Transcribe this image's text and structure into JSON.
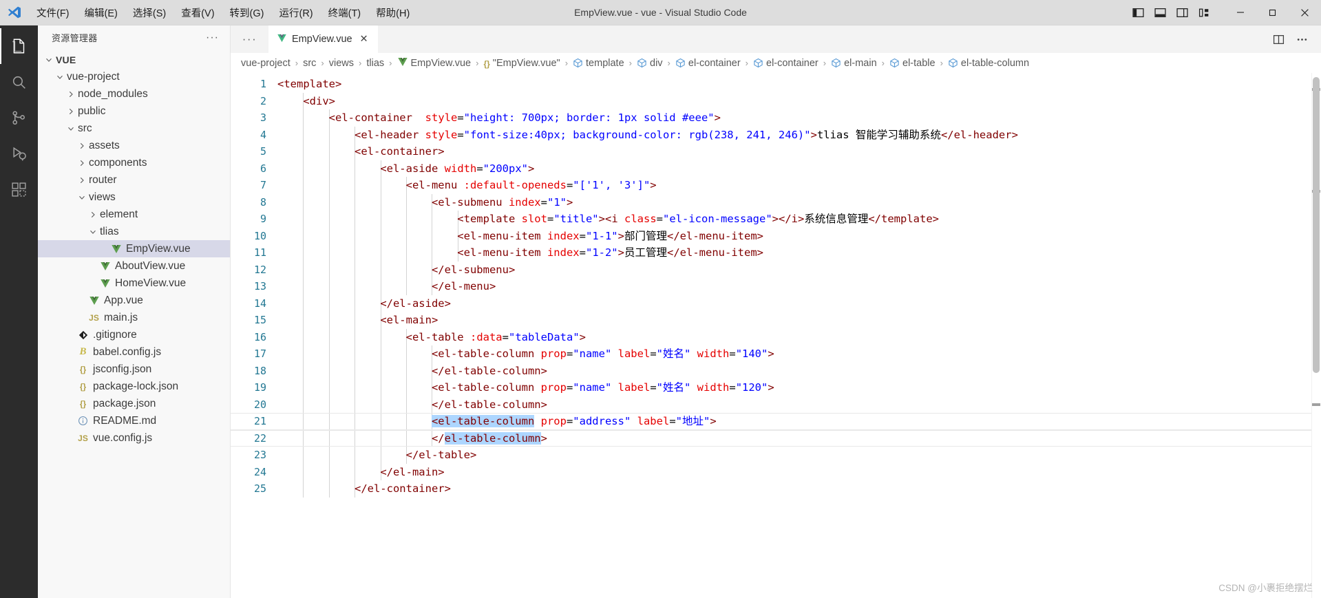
{
  "window": {
    "title": "EmpView.vue - vue - Visual Studio Code",
    "logo_icon": "vscode-logo-icon",
    "menu": [
      {
        "label": "文件(F)",
        "name": "menu-file"
      },
      {
        "label": "编辑(E)",
        "name": "menu-edit"
      },
      {
        "label": "选择(S)",
        "name": "menu-selection"
      },
      {
        "label": "查看(V)",
        "name": "menu-view"
      },
      {
        "label": "转到(G)",
        "name": "menu-go"
      },
      {
        "label": "运行(R)",
        "name": "menu-run"
      },
      {
        "label": "终端(T)",
        "name": "menu-terminal"
      },
      {
        "label": "帮助(H)",
        "name": "menu-help"
      }
    ],
    "layout_icons": [
      {
        "name": "toggle-primary-sidebar-icon"
      },
      {
        "name": "toggle-panel-icon"
      },
      {
        "name": "toggle-secondary-sidebar-icon"
      },
      {
        "name": "customize-layout-icon"
      }
    ],
    "controls": [
      {
        "name": "minimize-button",
        "glyph": "─"
      },
      {
        "name": "maximize-button",
        "glyph": "❐"
      },
      {
        "name": "close-button",
        "glyph": "✕"
      }
    ]
  },
  "activitybar": {
    "items": [
      {
        "name": "activity-explorer",
        "icon": "files-icon",
        "active": true
      },
      {
        "name": "activity-search",
        "icon": "search-icon",
        "active": false
      },
      {
        "name": "activity-source-control",
        "icon": "source-control-icon",
        "active": false
      },
      {
        "name": "activity-run-debug",
        "icon": "run-and-debug-icon",
        "active": false
      },
      {
        "name": "activity-extensions",
        "icon": "extensions-icon",
        "active": false
      }
    ]
  },
  "sidebar": {
    "title": "资源管理器",
    "more_actions": "···",
    "tree": [
      {
        "label": "VUE",
        "indent": 0,
        "twisty": "down",
        "icon": "none",
        "bold": true,
        "selected": false
      },
      {
        "label": "vue-project",
        "indent": 1,
        "twisty": "down",
        "icon": "none",
        "bold": false,
        "selected": false
      },
      {
        "label": "node_modules",
        "indent": 2,
        "twisty": "right",
        "icon": "none",
        "bold": false,
        "selected": false
      },
      {
        "label": "public",
        "indent": 2,
        "twisty": "right",
        "icon": "none",
        "bold": false,
        "selected": false
      },
      {
        "label": "src",
        "indent": 2,
        "twisty": "down",
        "icon": "none",
        "bold": false,
        "selected": false
      },
      {
        "label": "assets",
        "indent": 3,
        "twisty": "right",
        "icon": "none",
        "bold": false,
        "selected": false
      },
      {
        "label": "components",
        "indent": 3,
        "twisty": "right",
        "icon": "none",
        "bold": false,
        "selected": false
      },
      {
        "label": "router",
        "indent": 3,
        "twisty": "right",
        "icon": "none",
        "bold": false,
        "selected": false
      },
      {
        "label": "views",
        "indent": 3,
        "twisty": "down",
        "icon": "none",
        "bold": false,
        "selected": false
      },
      {
        "label": "element",
        "indent": 4,
        "twisty": "right",
        "icon": "none",
        "bold": false,
        "selected": false
      },
      {
        "label": "tlias",
        "indent": 4,
        "twisty": "down",
        "icon": "none",
        "bold": false,
        "selected": false
      },
      {
        "label": "EmpView.vue",
        "indent": 5,
        "twisty": "none",
        "icon": "vue",
        "bold": false,
        "selected": true
      },
      {
        "label": "AboutView.vue",
        "indent": 4,
        "twisty": "none",
        "icon": "vue",
        "bold": false,
        "selected": false
      },
      {
        "label": "HomeView.vue",
        "indent": 4,
        "twisty": "none",
        "icon": "vue",
        "bold": false,
        "selected": false
      },
      {
        "label": "App.vue",
        "indent": 3,
        "twisty": "none",
        "icon": "vue",
        "bold": false,
        "selected": false
      },
      {
        "label": "main.js",
        "indent": 3,
        "twisty": "none",
        "icon": "js",
        "bold": false,
        "selected": false
      },
      {
        "label": ".gitignore",
        "indent": 2,
        "twisty": "none",
        "icon": "git",
        "bold": false,
        "selected": false
      },
      {
        "label": "babel.config.js",
        "indent": 2,
        "twisty": "none",
        "icon": "babel",
        "bold": false,
        "selected": false
      },
      {
        "label": "jsconfig.json",
        "indent": 2,
        "twisty": "none",
        "icon": "json",
        "bold": false,
        "selected": false
      },
      {
        "label": "package-lock.json",
        "indent": 2,
        "twisty": "none",
        "icon": "json",
        "bold": false,
        "selected": false
      },
      {
        "label": "package.json",
        "indent": 2,
        "twisty": "none",
        "icon": "json",
        "bold": false,
        "selected": false
      },
      {
        "label": "README.md",
        "indent": 2,
        "twisty": "none",
        "icon": "readme",
        "bold": false,
        "selected": false
      },
      {
        "label": "vue.config.js",
        "indent": 2,
        "twisty": "none",
        "icon": "js",
        "bold": false,
        "selected": false
      }
    ]
  },
  "editor": {
    "more_tab_actions": "···",
    "tabs": [
      {
        "label": "EmpView.vue",
        "icon": "vue-file-icon",
        "close": "✕",
        "active": true
      }
    ],
    "tab_actions": [
      {
        "name": "split-editor-icon"
      },
      {
        "name": "more-actions-icon"
      }
    ],
    "breadcrumbs": [
      {
        "label": "vue-project",
        "icon": "none"
      },
      {
        "label": "src",
        "icon": "none"
      },
      {
        "label": "views",
        "icon": "none"
      },
      {
        "label": "tlias",
        "icon": "none"
      },
      {
        "label": "EmpView.vue",
        "icon": "vue"
      },
      {
        "label": "\"EmpView.vue\"",
        "icon": "brace"
      },
      {
        "label": "template",
        "icon": "cube"
      },
      {
        "label": "div",
        "icon": "cube"
      },
      {
        "label": "el-container",
        "icon": "cube"
      },
      {
        "label": "el-container",
        "icon": "cube"
      },
      {
        "label": "el-main",
        "icon": "cube"
      },
      {
        "label": "el-table",
        "icon": "cube"
      },
      {
        "label": "el-table-column",
        "icon": "cube"
      }
    ],
    "line_numbers": [
      "1",
      "2",
      "3",
      "4",
      "5",
      "6",
      "7",
      "8",
      "9",
      "10",
      "11",
      "12",
      "13",
      "14",
      "15",
      "16",
      "17",
      "18",
      "19",
      "20",
      "21",
      "22",
      "23",
      "24",
      "25"
    ],
    "code_lines": [
      {
        "n": 1,
        "indent": 0,
        "tokens": [
          {
            "t": "tag",
            "v": "<template>"
          }
        ]
      },
      {
        "n": 2,
        "indent": 1,
        "tokens": [
          {
            "t": "tag",
            "v": "<div>"
          }
        ]
      },
      {
        "n": 3,
        "indent": 2,
        "tokens": [
          {
            "t": "tag",
            "v": "<el-container"
          },
          {
            "t": "txt",
            "v": "  "
          },
          {
            "t": "attr",
            "v": "style"
          },
          {
            "t": "punc",
            "v": "="
          },
          {
            "t": "val",
            "v": "\"height: 700px; border: 1px solid #eee\""
          },
          {
            "t": "tag",
            "v": ">"
          }
        ]
      },
      {
        "n": 4,
        "indent": 3,
        "tokens": [
          {
            "t": "tag",
            "v": "<el-header"
          },
          {
            "t": "txt",
            "v": " "
          },
          {
            "t": "attr",
            "v": "style"
          },
          {
            "t": "punc",
            "v": "="
          },
          {
            "t": "val",
            "v": "\"font-size:40px; background-color: rgb(238, 241, 246)\""
          },
          {
            "t": "tag",
            "v": ">"
          },
          {
            "t": "txt",
            "v": "tlias 智能学习辅助系统"
          },
          {
            "t": "tag",
            "v": "</el-header>"
          }
        ]
      },
      {
        "n": 5,
        "indent": 3,
        "tokens": [
          {
            "t": "tag",
            "v": "<el-container>"
          }
        ]
      },
      {
        "n": 6,
        "indent": 4,
        "tokens": [
          {
            "t": "tag",
            "v": "<el-aside"
          },
          {
            "t": "txt",
            "v": " "
          },
          {
            "t": "attr",
            "v": "width"
          },
          {
            "t": "punc",
            "v": "="
          },
          {
            "t": "val",
            "v": "\"200px\""
          },
          {
            "t": "tag",
            "v": ">"
          }
        ]
      },
      {
        "n": 7,
        "indent": 5,
        "tokens": [
          {
            "t": "tag",
            "v": "<el-menu"
          },
          {
            "t": "txt",
            "v": " "
          },
          {
            "t": "attr",
            "v": ":default-openeds"
          },
          {
            "t": "punc",
            "v": "="
          },
          {
            "t": "val",
            "v": "\"['1', '3']\""
          },
          {
            "t": "tag",
            "v": ">"
          }
        ]
      },
      {
        "n": 8,
        "indent": 6,
        "tokens": [
          {
            "t": "tag",
            "v": "<el-submenu"
          },
          {
            "t": "txt",
            "v": " "
          },
          {
            "t": "attr",
            "v": "index"
          },
          {
            "t": "punc",
            "v": "="
          },
          {
            "t": "val",
            "v": "\"1\""
          },
          {
            "t": "tag",
            "v": ">"
          }
        ]
      },
      {
        "n": 9,
        "indent": 7,
        "tokens": [
          {
            "t": "tag",
            "v": "<template"
          },
          {
            "t": "txt",
            "v": " "
          },
          {
            "t": "attr",
            "v": "slot"
          },
          {
            "t": "punc",
            "v": "="
          },
          {
            "t": "val",
            "v": "\"title\""
          },
          {
            "t": "tag",
            "v": ">"
          },
          {
            "t": "tag",
            "v": "<i"
          },
          {
            "t": "txt",
            "v": " "
          },
          {
            "t": "attr",
            "v": "class"
          },
          {
            "t": "punc",
            "v": "="
          },
          {
            "t": "val",
            "v": "\"el-icon-message\""
          },
          {
            "t": "tag",
            "v": ">"
          },
          {
            "t": "tag",
            "v": "</i>"
          },
          {
            "t": "txt",
            "v": "系统信息管理"
          },
          {
            "t": "tag",
            "v": "</template>"
          }
        ]
      },
      {
        "n": 10,
        "indent": 7,
        "tokens": [
          {
            "t": "tag",
            "v": "<el-menu-item"
          },
          {
            "t": "txt",
            "v": " "
          },
          {
            "t": "attr",
            "v": "index"
          },
          {
            "t": "punc",
            "v": "="
          },
          {
            "t": "val",
            "v": "\"1-1\""
          },
          {
            "t": "tag",
            "v": ">"
          },
          {
            "t": "txt",
            "v": "部门管理"
          },
          {
            "t": "tag",
            "v": "</el-menu-item>"
          }
        ]
      },
      {
        "n": 11,
        "indent": 7,
        "tokens": [
          {
            "t": "tag",
            "v": "<el-menu-item"
          },
          {
            "t": "txt",
            "v": " "
          },
          {
            "t": "attr",
            "v": "index"
          },
          {
            "t": "punc",
            "v": "="
          },
          {
            "t": "val",
            "v": "\"1-2\""
          },
          {
            "t": "tag",
            "v": ">"
          },
          {
            "t": "txt",
            "v": "员工管理"
          },
          {
            "t": "tag",
            "v": "</el-menu-item>"
          }
        ]
      },
      {
        "n": 12,
        "indent": 6,
        "tokens": [
          {
            "t": "tag",
            "v": "</el-submenu>"
          }
        ]
      },
      {
        "n": 13,
        "indent": 6,
        "tokens": [
          {
            "t": "tag",
            "v": "</el-menu>"
          }
        ]
      },
      {
        "n": 14,
        "indent": 4,
        "tokens": [
          {
            "t": "tag",
            "v": "</el-aside>"
          }
        ]
      },
      {
        "n": 15,
        "indent": 4,
        "tokens": [
          {
            "t": "tag",
            "v": "<el-main>"
          }
        ]
      },
      {
        "n": 16,
        "indent": 5,
        "tokens": [
          {
            "t": "tag",
            "v": "<el-table"
          },
          {
            "t": "txt",
            "v": " "
          },
          {
            "t": "attr",
            "v": ":data"
          },
          {
            "t": "punc",
            "v": "="
          },
          {
            "t": "val",
            "v": "\"tableData\""
          },
          {
            "t": "tag",
            "v": ">"
          }
        ]
      },
      {
        "n": 17,
        "indent": 6,
        "tokens": [
          {
            "t": "tag",
            "v": "<el-table-column"
          },
          {
            "t": "txt",
            "v": " "
          },
          {
            "t": "attr",
            "v": "prop"
          },
          {
            "t": "punc",
            "v": "="
          },
          {
            "t": "val",
            "v": "\"name\""
          },
          {
            "t": "txt",
            "v": " "
          },
          {
            "t": "attr",
            "v": "label"
          },
          {
            "t": "punc",
            "v": "="
          },
          {
            "t": "val",
            "v": "\"姓名\""
          },
          {
            "t": "txt",
            "v": " "
          },
          {
            "t": "attr",
            "v": "width"
          },
          {
            "t": "punc",
            "v": "="
          },
          {
            "t": "val",
            "v": "\"140\""
          },
          {
            "t": "tag",
            "v": ">"
          }
        ]
      },
      {
        "n": 18,
        "indent": 6,
        "tokens": [
          {
            "t": "tag",
            "v": "</el-table-column>"
          }
        ]
      },
      {
        "n": 19,
        "indent": 6,
        "tokens": [
          {
            "t": "tag",
            "v": "<el-table-column"
          },
          {
            "t": "txt",
            "v": " "
          },
          {
            "t": "attr",
            "v": "prop"
          },
          {
            "t": "punc",
            "v": "="
          },
          {
            "t": "val",
            "v": "\"name\""
          },
          {
            "t": "txt",
            "v": " "
          },
          {
            "t": "attr",
            "v": "label"
          },
          {
            "t": "punc",
            "v": "="
          },
          {
            "t": "val",
            "v": "\"姓名\""
          },
          {
            "t": "txt",
            "v": " "
          },
          {
            "t": "attr",
            "v": "width"
          },
          {
            "t": "punc",
            "v": "="
          },
          {
            "t": "val",
            "v": "\"120\""
          },
          {
            "t": "tag",
            "v": ">"
          }
        ]
      },
      {
        "n": 20,
        "indent": 6,
        "tokens": [
          {
            "t": "tag",
            "v": "</el-table-column>"
          }
        ]
      },
      {
        "n": 21,
        "indent": 6,
        "selected": true,
        "tokens": [
          {
            "t": "tag sel",
            "v": "<el-table-column"
          },
          {
            "t": "txt",
            "v": " "
          },
          {
            "t": "attr",
            "v": "prop"
          },
          {
            "t": "punc",
            "v": "="
          },
          {
            "t": "val",
            "v": "\"address\""
          },
          {
            "t": "txt",
            "v": " "
          },
          {
            "t": "attr",
            "v": "label"
          },
          {
            "t": "punc",
            "v": "="
          },
          {
            "t": "val",
            "v": "\"地址\""
          },
          {
            "t": "tag",
            "v": ">"
          }
        ]
      },
      {
        "n": 22,
        "indent": 6,
        "selected": true,
        "tokens": [
          {
            "t": "tag",
            "v": "</"
          },
          {
            "t": "tag sel",
            "v": "el-table-column"
          },
          {
            "t": "tag",
            "v": ">"
          }
        ]
      },
      {
        "n": 23,
        "indent": 5,
        "tokens": [
          {
            "t": "tag",
            "v": "</el-table>"
          }
        ]
      },
      {
        "n": 24,
        "indent": 4,
        "tokens": [
          {
            "t": "tag",
            "v": "</el-main>"
          }
        ]
      },
      {
        "n": 25,
        "indent": 3,
        "tokens": [
          {
            "t": "tag",
            "v": "</el-container>"
          }
        ]
      }
    ]
  },
  "watermark": "CSDN @小裹拒绝摆烂",
  "colors": {
    "titlebar_bg": "#dddddd",
    "activitybar_bg": "#2c2c2c",
    "sidebar_bg": "#f8f8f8",
    "editor_bg": "#ffffff",
    "selection": "#add6ff",
    "tree_selection": "#d7d8e8",
    "line_number": "#237893",
    "tag": "#800000",
    "attribute": "#e50000",
    "value": "#0000ff",
    "vue_green": "#41b883",
    "cube_blue": "#5b9bd5"
  }
}
